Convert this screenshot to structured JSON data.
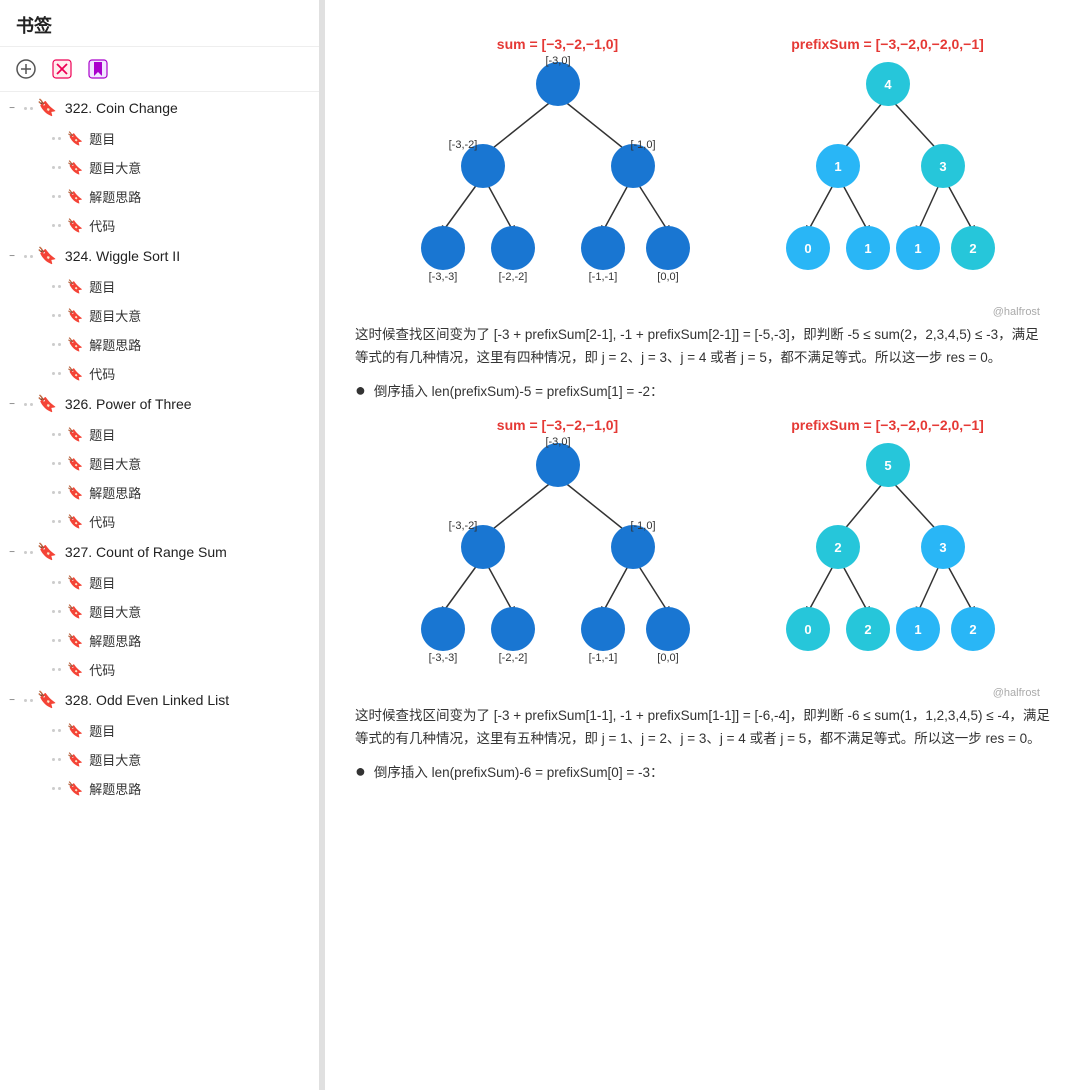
{
  "sidebar": {
    "title": "书签",
    "toolbar": {
      "add_icon": "+",
      "delete_icon": "✕",
      "bookmark_icon": "🔖"
    },
    "sections": [
      {
        "id": "322",
        "title": "322. Coin Change",
        "collapsed": false,
        "items": [
          "题目",
          "题目大意",
          "解题思路",
          "代码"
        ]
      },
      {
        "id": "324",
        "title": "324. Wiggle Sort II",
        "collapsed": false,
        "items": [
          "题目",
          "题目大意",
          "解题思路",
          "代码"
        ]
      },
      {
        "id": "326",
        "title": "326. Power of Three",
        "collapsed": false,
        "items": [
          "题目",
          "题目大意",
          "解题思路",
          "代码"
        ]
      },
      {
        "id": "327",
        "title": "327. Count of Range Sum",
        "collapsed": false,
        "items": [
          "题目",
          "题目大意",
          "解题思路",
          "代码"
        ]
      },
      {
        "id": "328",
        "title": "328. Odd Even Linked List",
        "collapsed": false,
        "items": [
          "题目",
          "题目大意",
          "解题思路"
        ]
      }
    ]
  },
  "main": {
    "diagram1": {
      "sum_label": "sum = [−3,−2,−1,0]",
      "prefix_label": "prefixSum = [−3,−2,0,−2,0,−1]",
      "watermark": "@halfrost"
    },
    "text1": "这时候查找区间变为了 [-3 + prefixSum[2-1], -1 + prefixSum[2-1]] = [-5,-3]，即判断 -5 ≤ sum(2，2,3,4,5) ≤ -3，满足等式的有几种情况，这里有四种情况，即 j = 2、j = 3、j = 4 或者 j = 5，都不满足等式。所以这一步 res = 0。",
    "bullet1": "倒序插入 len(prefixSum)-5 = prefixSum[1] = -2：",
    "diagram2": {
      "sum_label": "sum = [−3,−2,−1,0]",
      "prefix_label": "prefixSum = [−3,−2,0,−2,0,−1]",
      "watermark": "@halfrost"
    },
    "text2": "这时候查找区间变为了 [-3 + prefixSum[1-1], -1 + prefixSum[1-1]] = [-6,-4]，即判断 -6 ≤ sum(1，1,2,3,4,5) ≤ -4，满足等式的有几种情况，这里有五种情况，即 j = 1、j = 2、j = 3、j = 4 或者 j = 5，都不满足等式。所以这一步 res = 0。",
    "bullet2": "倒序插入 len(prefixSum)-6 = prefixSum[0] = -3："
  }
}
